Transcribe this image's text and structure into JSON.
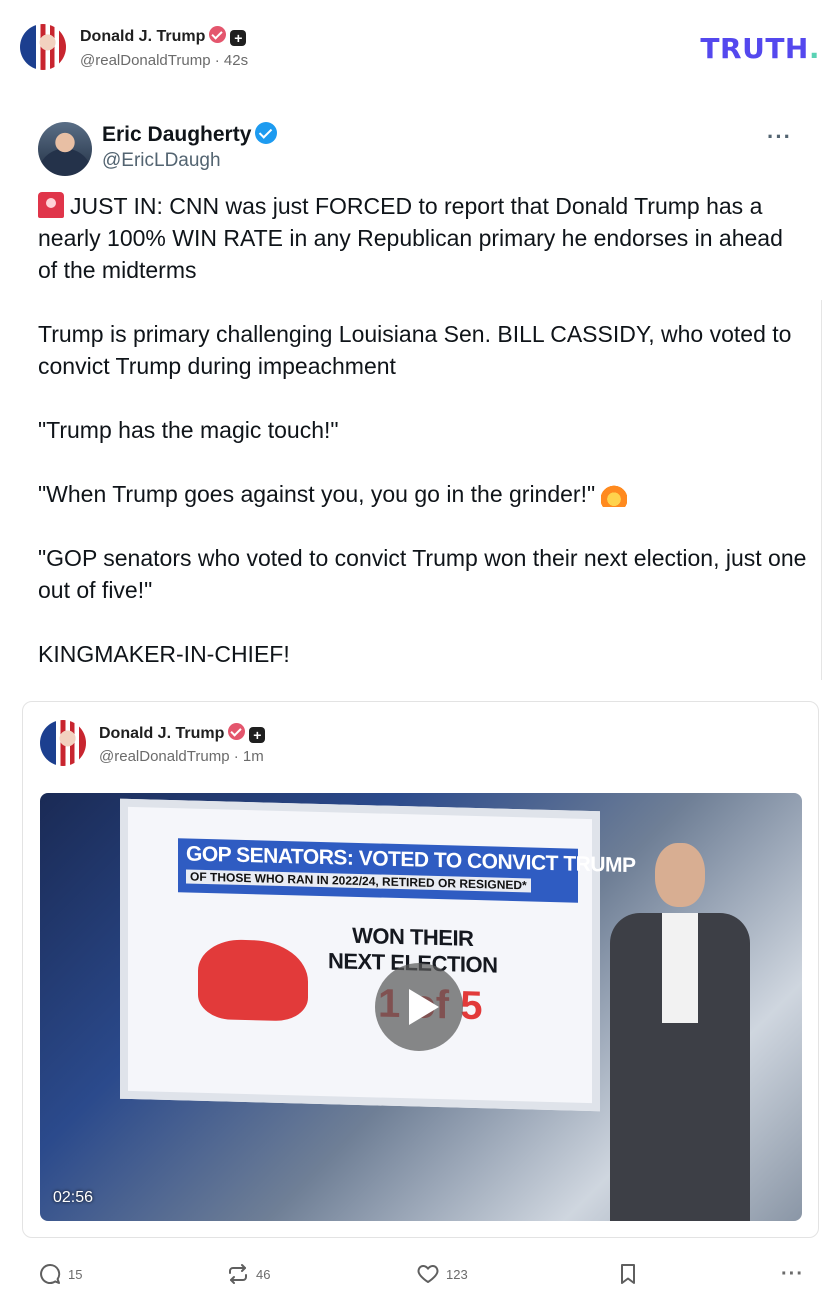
{
  "post": {
    "author_name": "Donald J. Trump",
    "author_handle": "@realDonaldTrump",
    "time_separator": " · ",
    "timestamp": "42s",
    "brand_logo_text": "TRUTH",
    "brand_logo_dot": "."
  },
  "tweet": {
    "author_name": "Eric Daugherty",
    "author_handle": "@EricLDaugh",
    "more_label": "···",
    "paragraphs": [
      "JUST IN: CNN was just FORCED to report that Donald Trump has a nearly 100% WIN RATE in any Republican primary he endorses in ahead of the midterms",
      "Trump is primary challenging Louisiana Sen. BILL CASSIDY, who voted to convict Trump during impeachment",
      "\"Trump has the magic touch!\"",
      "\"When Trump goes against you, you go in the grinder!\"",
      "\"GOP senators who voted to convict Trump won their next election, just one out of five!\"",
      "KINGMAKER-IN-CHIEF!"
    ],
    "emoji": {
      "first_paragraph": "siren-emoji",
      "fourth_paragraph": "fire-emoji"
    }
  },
  "quoted_truth": {
    "author_name": "Donald J. Trump",
    "author_handle": "@realDonaldTrump",
    "time_separator": " · ",
    "timestamp": "1m",
    "video": {
      "duration": "02:56",
      "banner_title": "GOP SENATORS: VOTED TO CONVICT TRUMP",
      "banner_subtitle": "OF THOSE WHO RAN IN 2022/24, RETIRED OR RESIGNED*",
      "headline_line1": "WON THEIR",
      "headline_line2": "NEXT ELECTION",
      "score": "1 of 5"
    }
  },
  "actions": {
    "reply_count": "15",
    "repost_count": "46",
    "like_count": "123",
    "more_label": "···"
  },
  "colors": {
    "truth_brand": "#5448ee",
    "truth_dot": "#5ad2b4",
    "verified_truth": "#e4566d",
    "verified_x": "#1d9bf0"
  }
}
